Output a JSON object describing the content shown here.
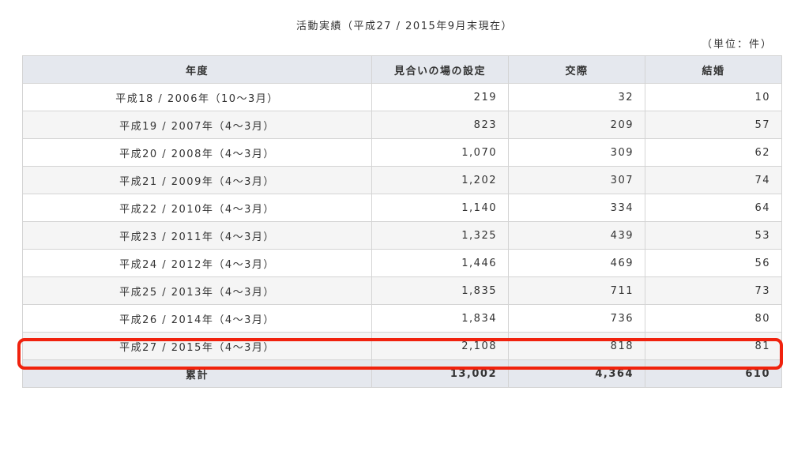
{
  "caption": "活動実績（平成27 / 2015年9月末現在）",
  "unit": "（単位：件）",
  "headers": [
    "年度",
    "見合いの場の設定",
    "交際",
    "結婚"
  ],
  "rows": [
    {
      "year": "平成18 / 2006年（10〜3月）",
      "meetings": "219",
      "dating": "32",
      "marriage": "10"
    },
    {
      "year": "平成19 / 2007年（4〜3月）",
      "meetings": "823",
      "dating": "209",
      "marriage": "57"
    },
    {
      "year": "平成20 / 2008年（4〜3月）",
      "meetings": "1,070",
      "dating": "309",
      "marriage": "62"
    },
    {
      "year": "平成21 / 2009年（4〜3月）",
      "meetings": "1,202",
      "dating": "307",
      "marriage": "74"
    },
    {
      "year": "平成22 / 2010年（4〜3月）",
      "meetings": "1,140",
      "dating": "334",
      "marriage": "64"
    },
    {
      "year": "平成23 / 2011年（4〜3月）",
      "meetings": "1,325",
      "dating": "439",
      "marriage": "53"
    },
    {
      "year": "平成24 / 2012年（4〜3月）",
      "meetings": "1,446",
      "dating": "469",
      "marriage": "56"
    },
    {
      "year": "平成25 / 2013年（4〜3月）",
      "meetings": "1,835",
      "dating": "711",
      "marriage": "73"
    },
    {
      "year": "平成26 / 2014年（4〜3月）",
      "meetings": "1,834",
      "dating": "736",
      "marriage": "80"
    },
    {
      "year": "平成27 / 2015年（4〜3月）",
      "meetings": "2,108",
      "dating": "818",
      "marriage": "81"
    }
  ],
  "total": {
    "label": "累計",
    "meetings": "13,002",
    "dating": "4,364",
    "marriage": "610"
  },
  "colors": {
    "header_bg": "#e5e8ee",
    "stripe_bg": "#f5f5f5",
    "highlight_border": "#f0220e"
  }
}
